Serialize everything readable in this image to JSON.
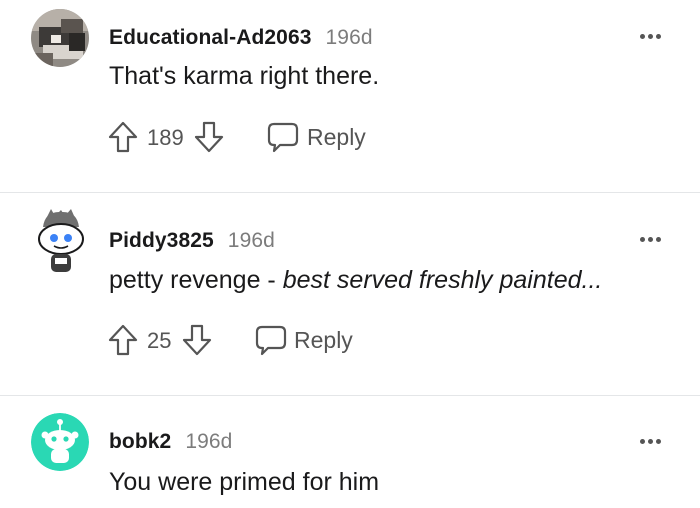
{
  "comments": [
    {
      "author": "Educational-Ad2063",
      "age": "196d",
      "text": "That's karma right there.",
      "score": "189",
      "reply_label": "Reply",
      "avatar": "photo-avatar"
    },
    {
      "author": "Piddy3825",
      "age": "196d",
      "text_plain": "petty revenge - ",
      "text_italic": "best served freshly painted...",
      "score": "25",
      "reply_label": "Reply",
      "avatar": "snoo-avatar"
    },
    {
      "author": "bobk2",
      "age": "196d",
      "text": "You were primed for him",
      "avatar": "teal-snoo-avatar"
    }
  ],
  "icons": {
    "upvote": "arrow-up-outline",
    "downvote": "arrow-down-outline",
    "reply": "speech-bubble",
    "more": "three-dots"
  },
  "colors": {
    "text": "#1a1a1b",
    "meta": "#7c7c7c",
    "action": "#555555",
    "divider": "#e4e6e8",
    "teal_avatar": "#2ad8b4"
  }
}
